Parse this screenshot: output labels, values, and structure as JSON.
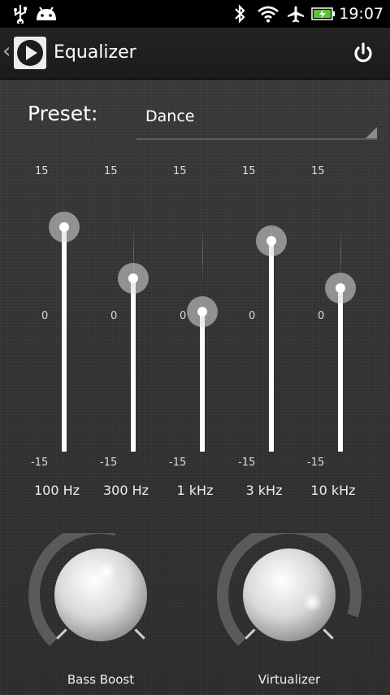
{
  "status_bar": {
    "time": "19:07",
    "icons": [
      "usb-icon",
      "android-icon",
      "bluetooth-icon",
      "wifi-icon",
      "airplane-icon",
      "battery-charging-icon"
    ]
  },
  "action_bar": {
    "title": "Equalizer",
    "back_icon": "chevron-left-icon",
    "app_icon": "play-icon",
    "power_icon": "power-icon"
  },
  "preset": {
    "label": "Preset:",
    "value": "Dance"
  },
  "equalizer": {
    "scale_max": "15",
    "scale_mid": "0",
    "scale_min": "-15",
    "range_db": [
      -15,
      15
    ],
    "bands": [
      {
        "label": "100 Hz",
        "level_db": 9
      },
      {
        "label": "300 Hz",
        "level_db": 3.5
      },
      {
        "label": "1 kHz",
        "level_db": 0
      },
      {
        "label": "3 kHz",
        "level_db": 7.5
      },
      {
        "label": "10 kHz",
        "level_db": 2.5
      }
    ]
  },
  "effects": {
    "bass_boost": {
      "label": "Bass Boost",
      "level": 0.55
    },
    "virtualizer": {
      "label": "Virtualizer",
      "level": 0.9
    }
  },
  "colors": {
    "battery": "#5bc236",
    "knob_arc": "#5a5a5a",
    "slider_fill": "#ffffff"
  }
}
